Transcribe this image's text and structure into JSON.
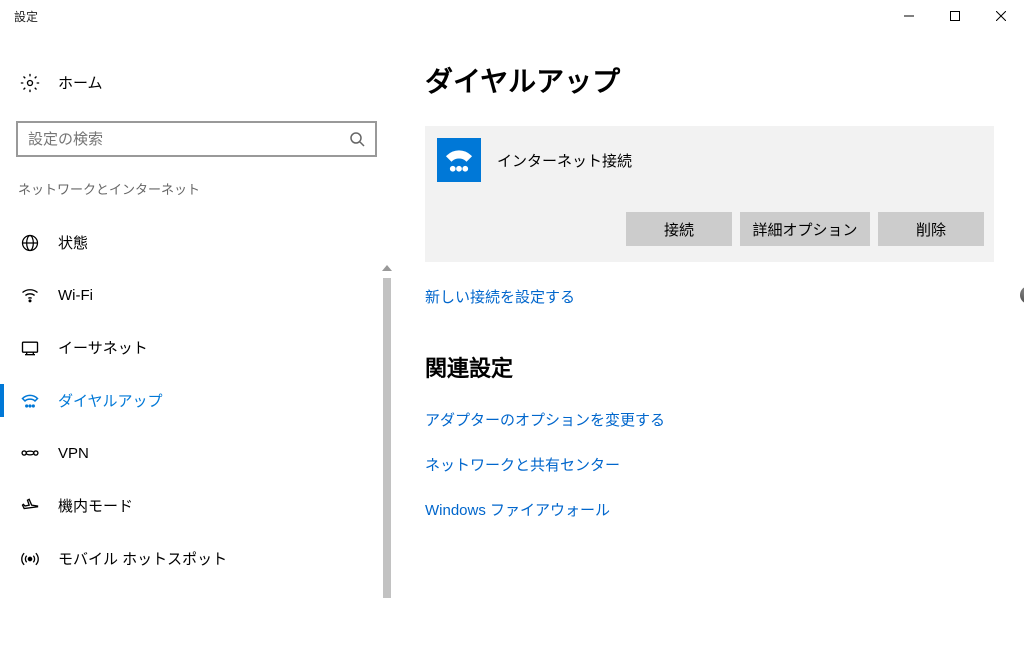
{
  "titlebar": {
    "title": "設定"
  },
  "sidebar": {
    "home_label": "ホーム",
    "search_placeholder": "設定の検索",
    "section_title": "ネットワークとインターネット",
    "items": [
      {
        "id": "status",
        "label": "状態",
        "active": false
      },
      {
        "id": "wifi",
        "label": "Wi-Fi",
        "active": false
      },
      {
        "id": "ethernet",
        "label": "イーサネット",
        "active": false
      },
      {
        "id": "dialup",
        "label": "ダイヤルアップ",
        "active": true
      },
      {
        "id": "vpn",
        "label": "VPN",
        "active": false
      },
      {
        "id": "airplane",
        "label": "機内モード",
        "active": false
      },
      {
        "id": "hotspot",
        "label": "モバイル ホットスポット",
        "active": false
      }
    ]
  },
  "main": {
    "page_title": "ダイヤルアップ",
    "connection_name": "インターネット接続",
    "buttons": {
      "connect": "接続",
      "advanced": "詳細オプション",
      "delete": "削除"
    },
    "new_connection_link": "新しい接続を設定する",
    "related_title": "関連設定",
    "related_links": [
      "アダプターのオプションを変更する",
      "ネットワークと共有センター",
      "Windows ファイアウォール"
    ]
  }
}
